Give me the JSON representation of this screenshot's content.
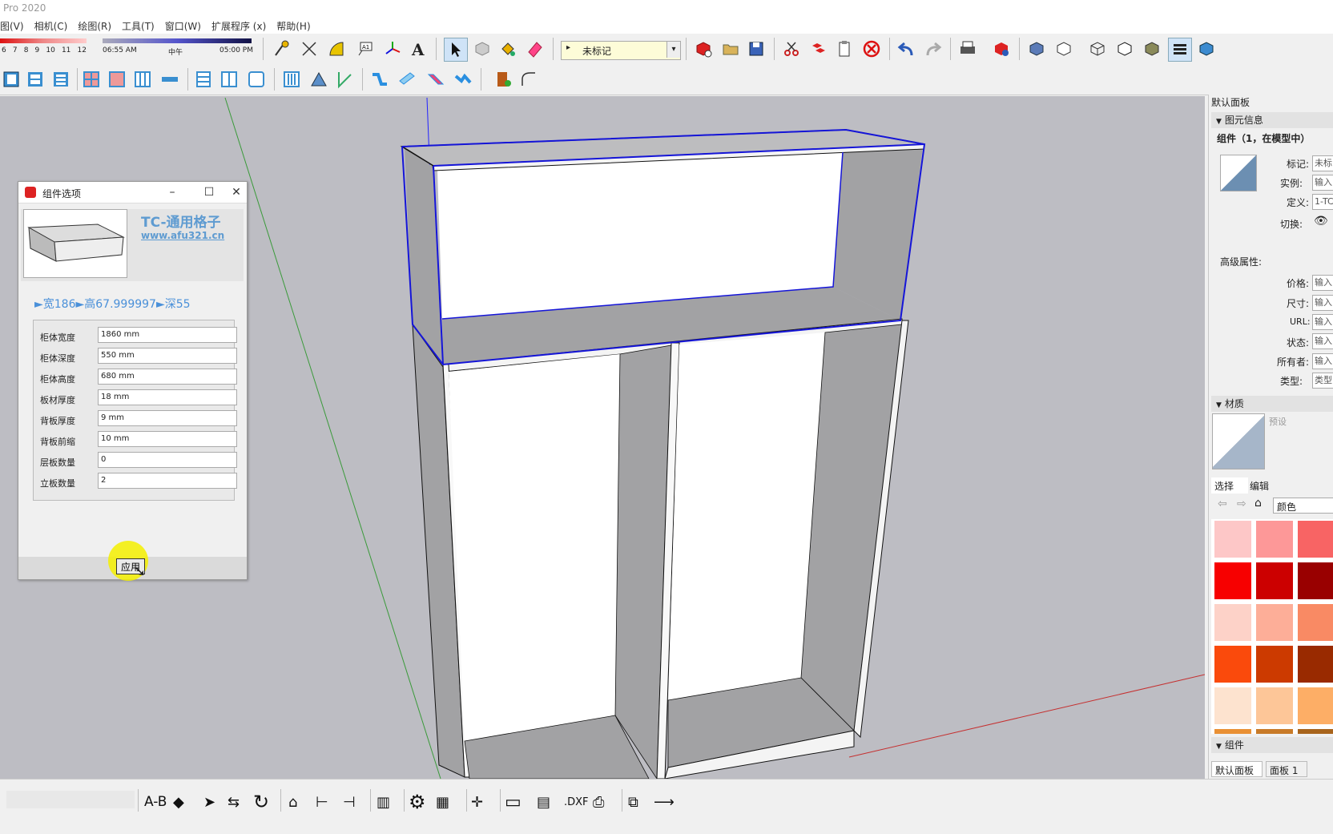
{
  "app": {
    "title": "Pro 2020"
  },
  "menu": [
    "图(V)",
    "相机(C)",
    "绘图(R)",
    "工具(T)",
    "窗口(W)",
    "扩展程序 (x)",
    "帮助(H)"
  ],
  "toolbar": {
    "month_ticks": [
      "6",
      "7",
      "8",
      "9",
      "10",
      "11",
      "12"
    ],
    "time_start": "06:55 AM",
    "time_noon": "中午",
    "time_end": "05:00 PM",
    "tag_select": "未标记"
  },
  "dialog": {
    "title": "组件选项",
    "brand_name": "TC-通用格子",
    "brand_url": "www.afu321.cn",
    "summary": "►宽186►高67.999997►深55",
    "fields": [
      {
        "label": "柜体宽度",
        "value": "1860 mm"
      },
      {
        "label": "柜体深度",
        "value": "550 mm"
      },
      {
        "label": "柜体高度",
        "value": "680 mm"
      },
      {
        "label": "板材厚度",
        "value": "18 mm"
      },
      {
        "label": "背板厚度",
        "value": "9 mm"
      },
      {
        "label": "背板前缩",
        "value": "10 mm"
      },
      {
        "label": "层板数量",
        "value": "0"
      },
      {
        "label": "立板数量",
        "value": "2"
      }
    ],
    "apply_button": "应用"
  },
  "right_panel": {
    "tray_title": "默认面板",
    "entity_info": {
      "header": "图元信息",
      "component_label": "组件（1，在模型中）",
      "tag_label": "标记:",
      "tag_value": "未标",
      "instance_label": "实例:",
      "instance_value": "输入",
      "definition_label": "定义:",
      "definition_value": "1-TC",
      "toggle_label": "切换:",
      "advanced_label": "高级属性:",
      "price_label": "价格:",
      "price_value": "输入",
      "size_label": "尺寸:",
      "size_value": "输入",
      "url_label": "URL:",
      "url_value": "输入",
      "status_label": "状态:",
      "status_value": "输入",
      "owner_label": "所有者:",
      "owner_value": "输入",
      "type_label": "类型:",
      "type_value": "类型"
    },
    "materials": {
      "header": "材质",
      "preset": "预设",
      "tab_select": "选择",
      "tab_edit": "编辑",
      "library": "颜色",
      "swatches": [
        "#fdc7c7",
        "#fd9898",
        "#f86464",
        "#f70000",
        "#cc0000",
        "#990000",
        "#fdd2c8",
        "#fdae98",
        "#f98a64",
        "#fa4a0c",
        "#cc3a00",
        "#992a00",
        "#fde3cf",
        "#fdc698",
        "#fdae66",
        "#e99034",
        "#c87a28",
        "#a8641c"
      ]
    },
    "components_header": "组件",
    "bottom_tabs": [
      "默认面板",
      "面板 1"
    ]
  },
  "bottom_toolbar": {
    "ab_label": "A-B",
    "dxf_label": ".DXF"
  },
  "colors": {
    "selection_blue": "#1515d8",
    "brand_blue": "#5e9bd1",
    "highlight_yellow": "#f5f000"
  }
}
